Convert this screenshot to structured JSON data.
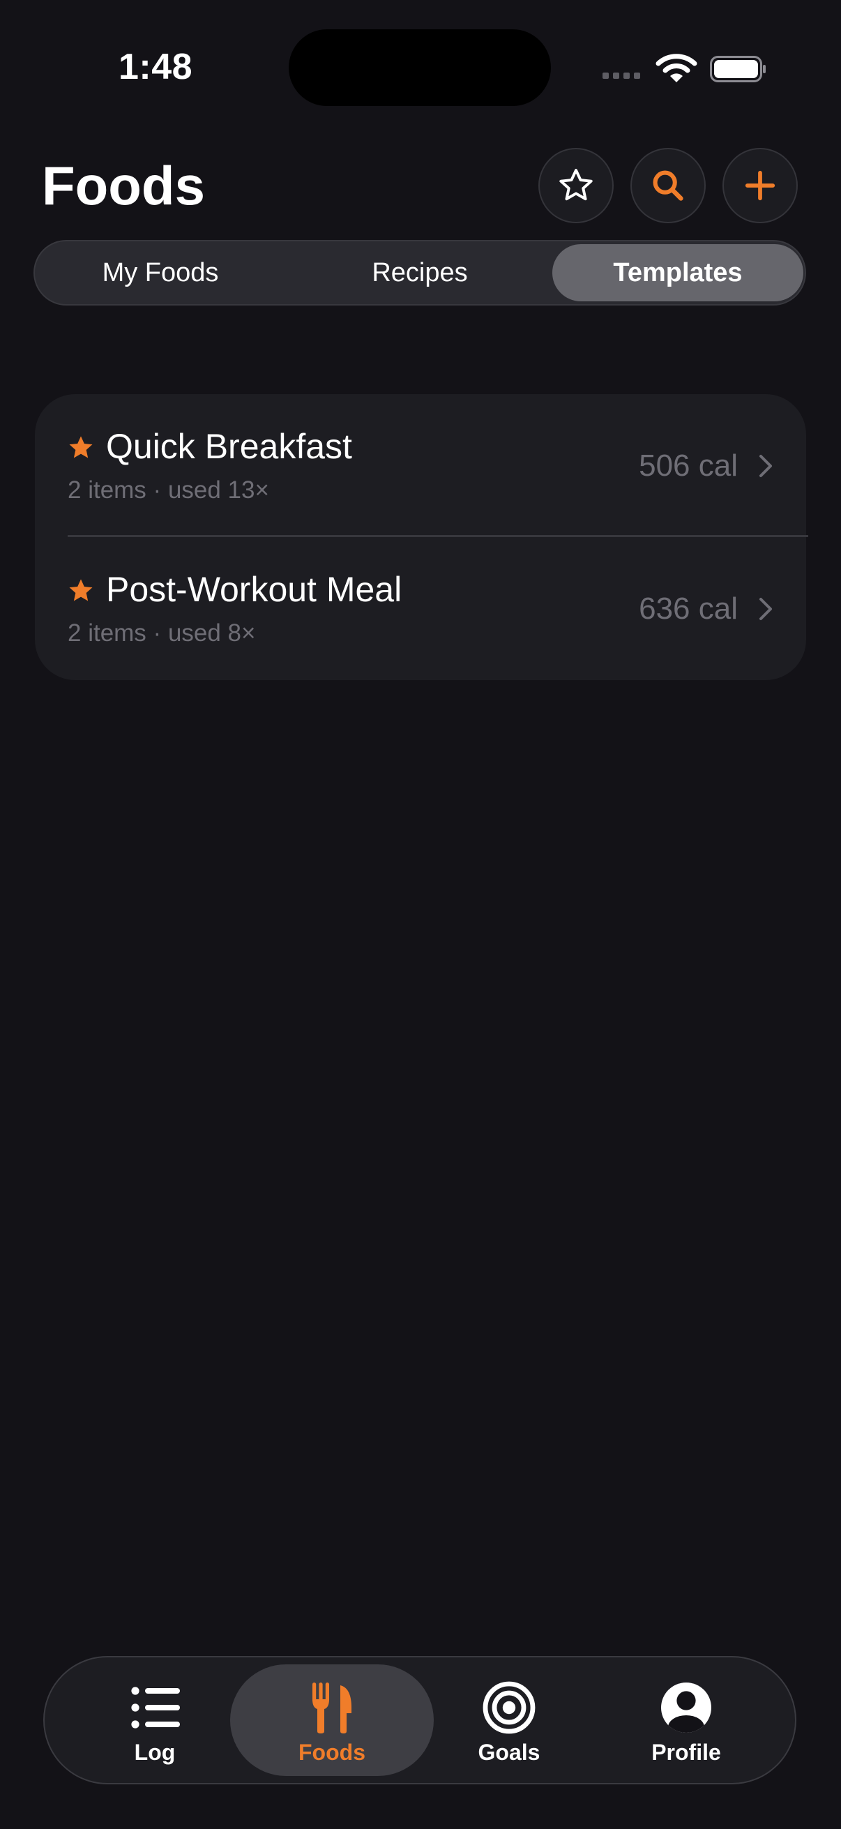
{
  "status": {
    "time": "1:48"
  },
  "header": {
    "title": "Foods"
  },
  "segments": [
    {
      "label": "My Foods",
      "active": false
    },
    {
      "label": "Recipes",
      "active": false
    },
    {
      "label": "Templates",
      "active": true
    }
  ],
  "templates": [
    {
      "name": "Quick Breakfast",
      "items": "2 items",
      "used": "used 13×",
      "calories": "506 cal",
      "favorite": true
    },
    {
      "name": "Post-Workout Meal",
      "items": "2 items",
      "used": "used 8×",
      "calories": "636 cal",
      "favorite": true
    }
  ],
  "tabs": [
    {
      "label": "Log",
      "icon": "list-icon",
      "active": false
    },
    {
      "label": "Foods",
      "icon": "fork-knife-icon",
      "active": true
    },
    {
      "label": "Goals",
      "icon": "target-icon",
      "active": false
    },
    {
      "label": "Profile",
      "icon": "person-circle-icon",
      "active": false
    }
  ],
  "colors": {
    "accent": "#f07d2a",
    "background": "#131217",
    "card": "#1d1d22",
    "secondary_text": "#6f6e76"
  }
}
